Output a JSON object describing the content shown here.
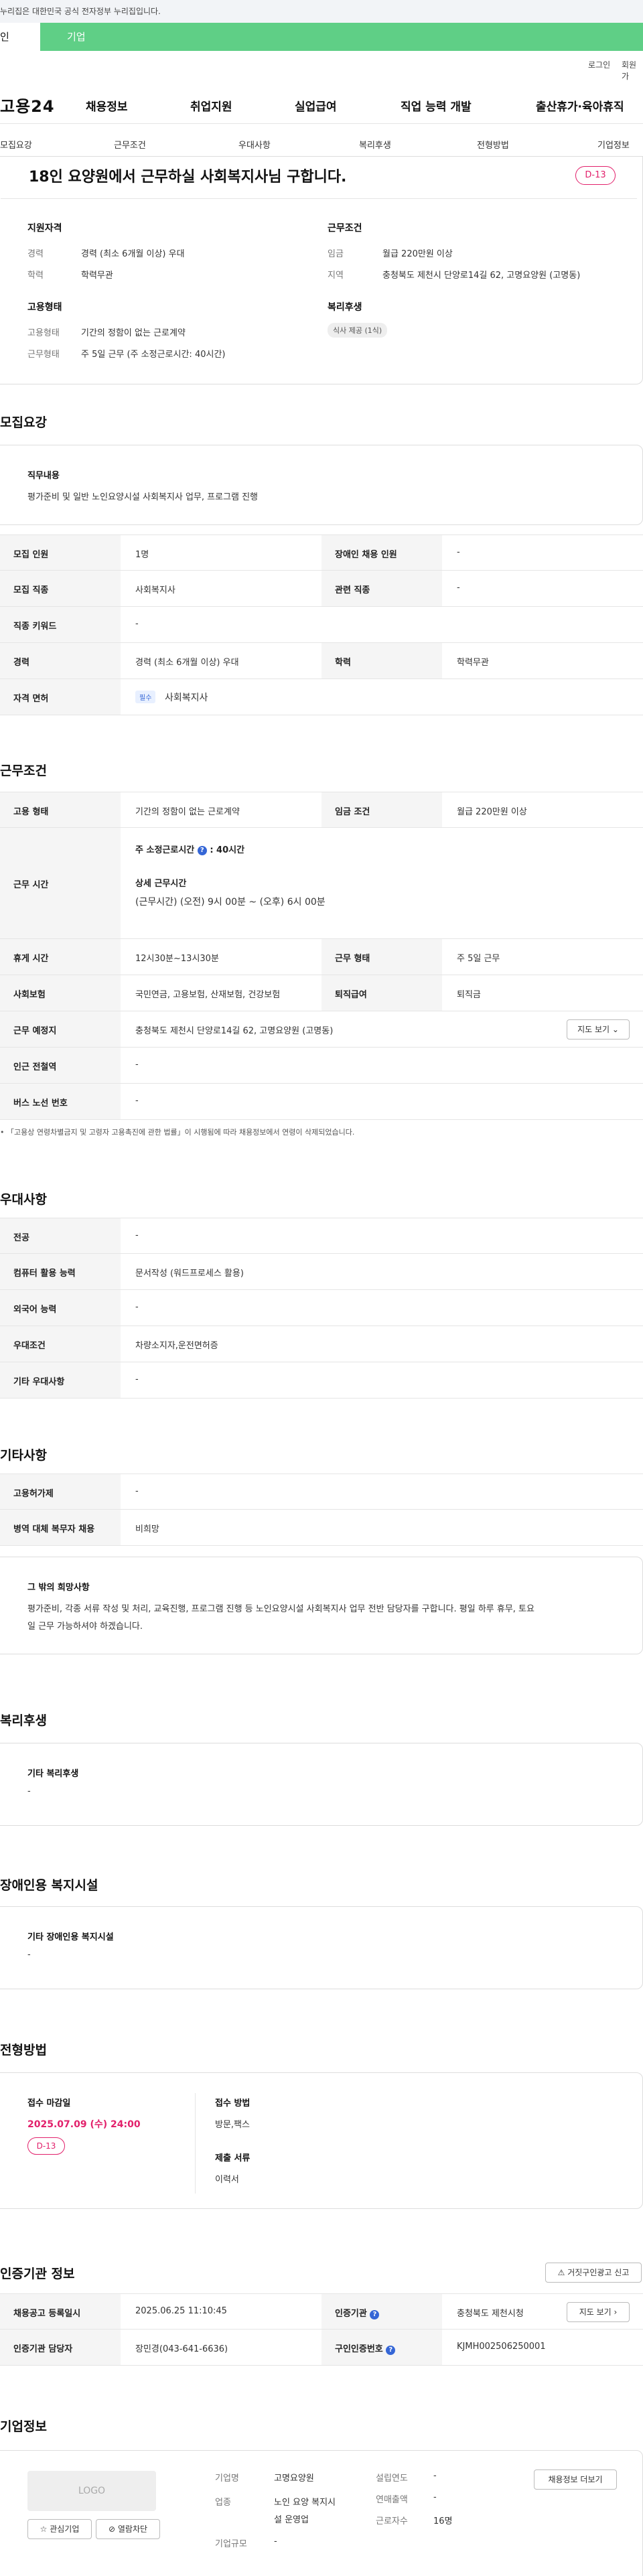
{
  "notice": "누리집은 대한민국 공식 전자정부 누리집입니다.",
  "user_tabs": [
    "인",
    "기업"
  ],
  "util_links": [
    "로그인",
    "회원가"
  ],
  "logo": "고용24",
  "gnb": [
    "채용정보",
    "취업지원",
    "실업급여",
    "직업 능력 개발",
    "출산휴가·육아휴직"
  ],
  "tabs": [
    "모집요강",
    "근무조건",
    "우대사항",
    "복리후생",
    "전형방법",
    "기업정보"
  ],
  "header": {
    "title": "18인 요양원에서 근무하실 사회복지사님 구합니다.",
    "dday": "D-13",
    "qual_title": "지원자격",
    "career_label": "경력",
    "career_value": "경력 (최소 6개월 이상) 우대",
    "edu_label": "학력",
    "edu_value": "학력무관",
    "cond_title": "근무조건",
    "wage_label": "임금",
    "wage_value": "월급 220만원 이상",
    "region_label": "지역",
    "region_value": "충청북도 제천시 단양로14길 62, 고명요양원 (고명동)",
    "emp_title": "고용형태",
    "emptype_label": "고용형태",
    "emptype_value": "기간의 정함이 없는 근로계약",
    "worktype_label": "근무형태",
    "worktype_value": "주 5일 근무 (주 소정근로시간: 40시간)",
    "welfare_title": "복리후생",
    "welfare_chip": "식사 제공 (1식)"
  },
  "recruit": {
    "section": "모집요강",
    "job_title": "직무내용",
    "job_desc": "평가준비 및 일반 노인요양시설 사회복지사 업무, 프로그램 진행",
    "rows": [
      {
        "k1": "모집 인원",
        "v1": "1명",
        "k2": "장애인 채용 인원",
        "v2": "-"
      },
      {
        "k1": "모집 직종",
        "v1": "사회복지사",
        "k2": "관련 직종",
        "v2": "-"
      },
      {
        "k1": "직종 키워드",
        "v1": "-"
      },
      {
        "k1": "경력",
        "v1": "경력 (최소 6개월 이상) 우대",
        "k2": "학력",
        "v2": "학력무관"
      }
    ],
    "license_k": "자격 면허",
    "license_tag": "필수",
    "license_v": "사회복지사"
  },
  "work": {
    "section": "근무조건",
    "r1k1": "고용 형태",
    "r1v1": "기간의 정함이 없는 근로계약",
    "r1k2": "임금 조건",
    "r1v2": "월급 220만원 이상",
    "hours_k": "근무 시간",
    "hours_week": "주 소정근로시간",
    "hours_week_val": ": 40시간",
    "hours_detail_title": "상세 근무시간",
    "hours_detail": "(근무시간) (오전) 9시 00분 ~ (오후) 6시 00분",
    "rest_k": "휴게 시간",
    "rest_v": "12시30분~13시30분",
    "form_k": "근무 형태",
    "form_v": "주 5일 근무",
    "ins_k": "사회보험",
    "ins_v": "국민연금, 고용보험, 산재보험, 건강보험",
    "ret_k": "퇴직급여",
    "ret_v": "퇴직금",
    "place_k": "근무 예정지",
    "place_v": "충청북도 제천시 단양로14길 62, 고명요양원 (고명동)",
    "map_btn": "지도 보기",
    "subway_k": "인근 전철역",
    "subway_v": "-",
    "bus_k": "버스 노선 번호",
    "bus_v": "-",
    "footnote": "「고용상 연령차별금지 및 고령자 고용촉진에 관한 법률」이 시행됨에 따라 채용정보에서 연령이 삭제되었습니다."
  },
  "pref": {
    "section": "우대사항",
    "rows": [
      {
        "k": "전공",
        "v": "-"
      },
      {
        "k": "컴퓨터 활용 능력",
        "v": "문서작성 (워드프로세스 활용)"
      },
      {
        "k": "외국어 능력",
        "v": "-"
      },
      {
        "k": "우대조건",
        "v": "차량소지자,운전면허증"
      },
      {
        "k": "기타 우대사항",
        "v": "-"
      }
    ]
  },
  "etc": {
    "section": "기타사항",
    "rows": [
      {
        "k": "고용허가제",
        "v": "-"
      },
      {
        "k": "병역 대체 복무자 채용",
        "v": "비희망"
      }
    ],
    "other_title": "그 밖의 희망사항",
    "other_desc_1": "평가준비, 각종 서류 작성 및 처리, 교육진행, 프로그램 진행 등 노인요양시설 사회복지사 업무 전반 담당자를 구합니다. 평일 하루 휴무, 토요",
    "other_desc_2": "일 근무 가능하셔야 하겠습니다."
  },
  "welfare": {
    "section": "복리후생",
    "box_title": "기타 복리후생",
    "box_value": "-"
  },
  "disabled": {
    "section": "장애인용 복지시설",
    "box_title": "기타 장애인용 복지시설",
    "box_value": "-"
  },
  "selection": {
    "section": "전형방법",
    "deadline_title": "접수 마감일",
    "deadline": "2025.07.09 (수) 24:00",
    "dday": "D-13",
    "method_title": "접수 방법",
    "method": "방문,팩스",
    "docs_title": "제출 서류",
    "docs": "이력서"
  },
  "cert": {
    "section": "인증기관 정보",
    "report_btn": "거짓구인광고 신고",
    "reg_k": "채용공고 등록일시",
    "reg_v": "2025.06.25 11:10:45",
    "org_k": "인증기관",
    "org_v": "충청북도 제천시청",
    "map_btn": "지도 보기",
    "mgr_k": "인증기관 담당자",
    "mgr_v": "장민경(043-641-6636)",
    "no_k": "구인인증번호",
    "no_v": "KJMH002506250001"
  },
  "company": {
    "section": "기업정보",
    "logo_text": "LOGO",
    "fav_btn": "관심기업",
    "visit_btn": "열람차단",
    "name_k": "기업명",
    "name_v": "고명요양원",
    "industry_k": "업종",
    "industry_v1": "노인 요양 복지시",
    "industry_v2": "설 운영업",
    "size_k": "기업규모",
    "size_v": "-",
    "found_k": "설립연도",
    "found_v": "-",
    "sales_k": "연매출액",
    "sales_v": "-",
    "emp_k": "근로자수",
    "emp_v": "16명",
    "more_btn": "채용정보 더보기"
  }
}
